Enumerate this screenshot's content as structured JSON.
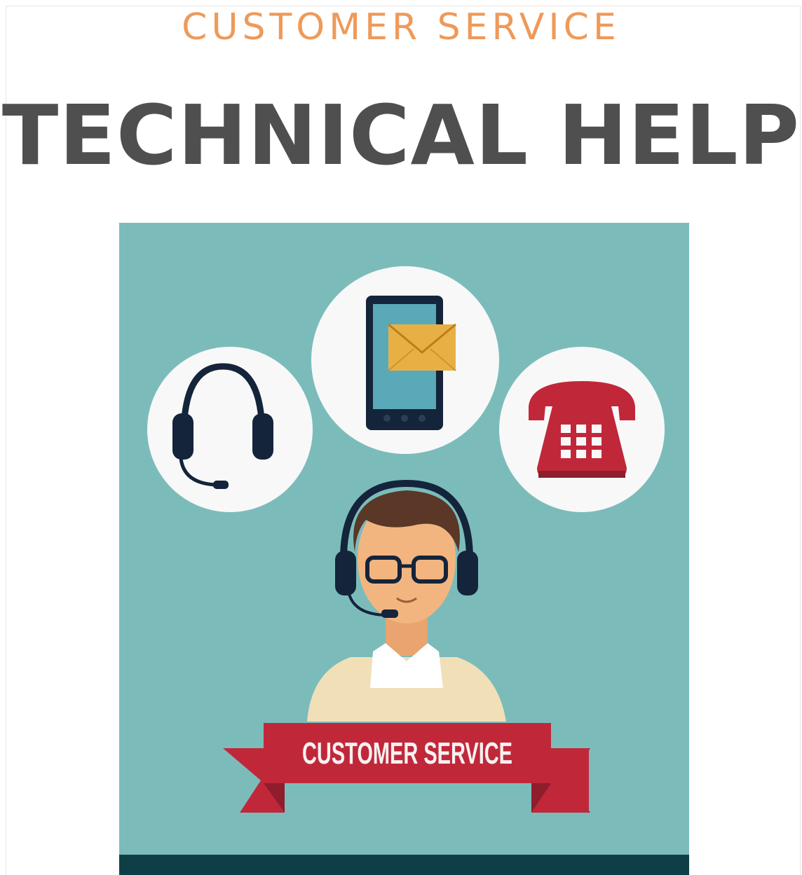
{
  "header": {
    "subtitle": "CUSTOMER SERVICE",
    "title": "TECHNICAL HELP"
  },
  "illustration": {
    "banner_label": "CUSTOMER SERVICE",
    "icons": [
      "headset-icon",
      "smartphone-mail-icon",
      "telephone-icon",
      "support-agent-avatar"
    ]
  },
  "colors": {
    "subtitle": "#ee9a5a",
    "title": "#4f4f4f",
    "panel": "#7bbcbb",
    "bottom_bar": "#0f3f46",
    "ribbon": "#c0283a",
    "ribbon_dark": "#8f1d2b",
    "circle": "#f8f8f8"
  }
}
